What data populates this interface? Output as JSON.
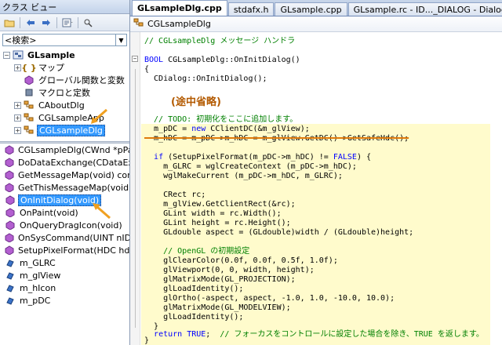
{
  "class_view": {
    "title": "クラス ビュー",
    "search_placeholder": "<検索>",
    "tree": [
      {
        "label": "GLsample",
        "bold": true
      },
      {
        "label": "マップ"
      },
      {
        "label": "グローバル関数と変数"
      },
      {
        "label": "マクロと定数"
      },
      {
        "label": "CAboutDlg"
      },
      {
        "label": "CGLsampleApp"
      },
      {
        "label": "CGLsampleDlg"
      }
    ],
    "members": [
      "CGLsampleDlg(CWnd *pPar",
      "DoDataExchange(CDataExc",
      "GetMessageMap(void) const",
      "GetThisMessageMap(void)",
      "OnInitDialog(void)",
      "OnPaint(void)",
      "OnQueryDragIcon(void)",
      "OnSysCommand(UINT nID,",
      "SetupPixelFormat(HDC hdc",
      "m_GLRC",
      "m_glView",
      "m_hIcon",
      "m_pDC"
    ]
  },
  "editor": {
    "tabs": [
      "GLsampleDlg.cpp",
      "stdafx.h",
      "GLsample.cpp",
      "GLsample.rc - ID..._DIALOG - Dialog"
    ],
    "breadcrumb": "CGLsampleDlg",
    "annotation": "(途中省略)",
    "lines": [
      "// CGLsampleDlg メッセージ ハンドラ",
      "",
      "BOOL CGLsampleDlg::OnInitDialog()",
      "{",
      "  CDialog::OnInitDialog();",
      "",
      "",
      "",
      "",
      "",
      "  // TODO: 初期化をここに追加します。",
      "  m_pDC = new CClientDC(&m_glView);",
      "  m_hDC = m_pDC->m_hDC = m_glView.GetDC()->GetSafeHdc();",
      "",
      "  if (SetupPixelFormat(m_pDC->m_hDC) != FALSE) {",
      "    m_GLRC = wglCreateContext (m_pDC->m_hDC);",
      "    wglMakeCurrent (m_pDC->m_hDC, m_GLRC);",
      "",
      "    CRect rc;",
      "    m_glView.GetClientRect(&rc);",
      "    GLint width = rc.Width();",
      "    GLint height = rc.Height();",
      "    GLdouble aspect = (GLdouble)width / (GLdouble)height;",
      "",
      "    // OpenGL の初期設定",
      "    glClearColor(0.0f, 0.0f, 0.5f, 1.0f);",
      "    glViewport(0, 0, width, height);",
      "    glMatrixMode(GL_PROJECTION);",
      "    glLoadIdentity();",
      "    glOrtho(-aspect, aspect, -1.0, 1.0, -10.0, 10.0);",
      "    glMatrixMode(GL_MODELVIEW);",
      "    glLoadIdentity();",
      "  }",
      "",
      "  return TRUE;  // フォーカスをコントロールに設定した場合を除き、TRUE を返します。",
      "}"
    ]
  },
  "colors": {
    "selection": "#3399ff",
    "highlight": "#fffbcc",
    "keyword": "#0000ff",
    "comment": "#008000",
    "annotation": "#b35a00",
    "arrow": "#f0a020"
  },
  "icons": [
    "back-icon",
    "forward-icon",
    "class-view-settings-icon",
    "folder-icon",
    "namespace-icon",
    "class-icon",
    "method-icon",
    "field-icon"
  ]
}
